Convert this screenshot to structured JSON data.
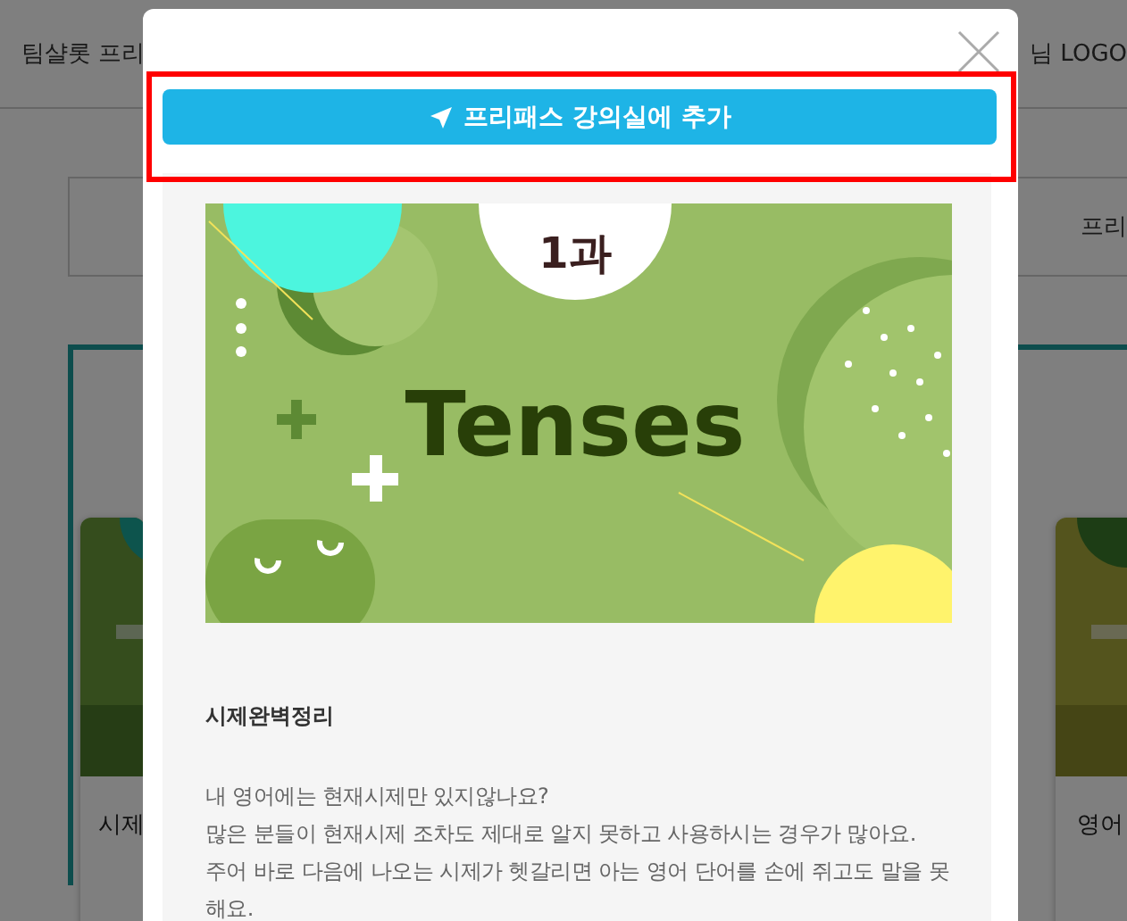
{
  "page": {
    "header_left": "팀샬롯 프리",
    "header_right": "님 LOGO",
    "tab_text": "프리",
    "cards": [
      {
        "title": "시제"
      },
      {
        "title": "영어"
      }
    ]
  },
  "modal": {
    "add_button": "프리패스 강의실에 추가",
    "banner": {
      "badge": "1과",
      "title": "Tenses"
    },
    "course_title": "시제완벽정리",
    "description": [
      "내 영어에는 현재시제만 있지않나요?",
      "많은 분들이 현재시제 조차도 제대로 알지 못하고 사용하시는 경우가 많아요.",
      "주어 바로 다음에 나오는 시제가 헷갈리면 아는 영어 단어를 손에 쥐고도 말을 못해요."
    ]
  }
}
